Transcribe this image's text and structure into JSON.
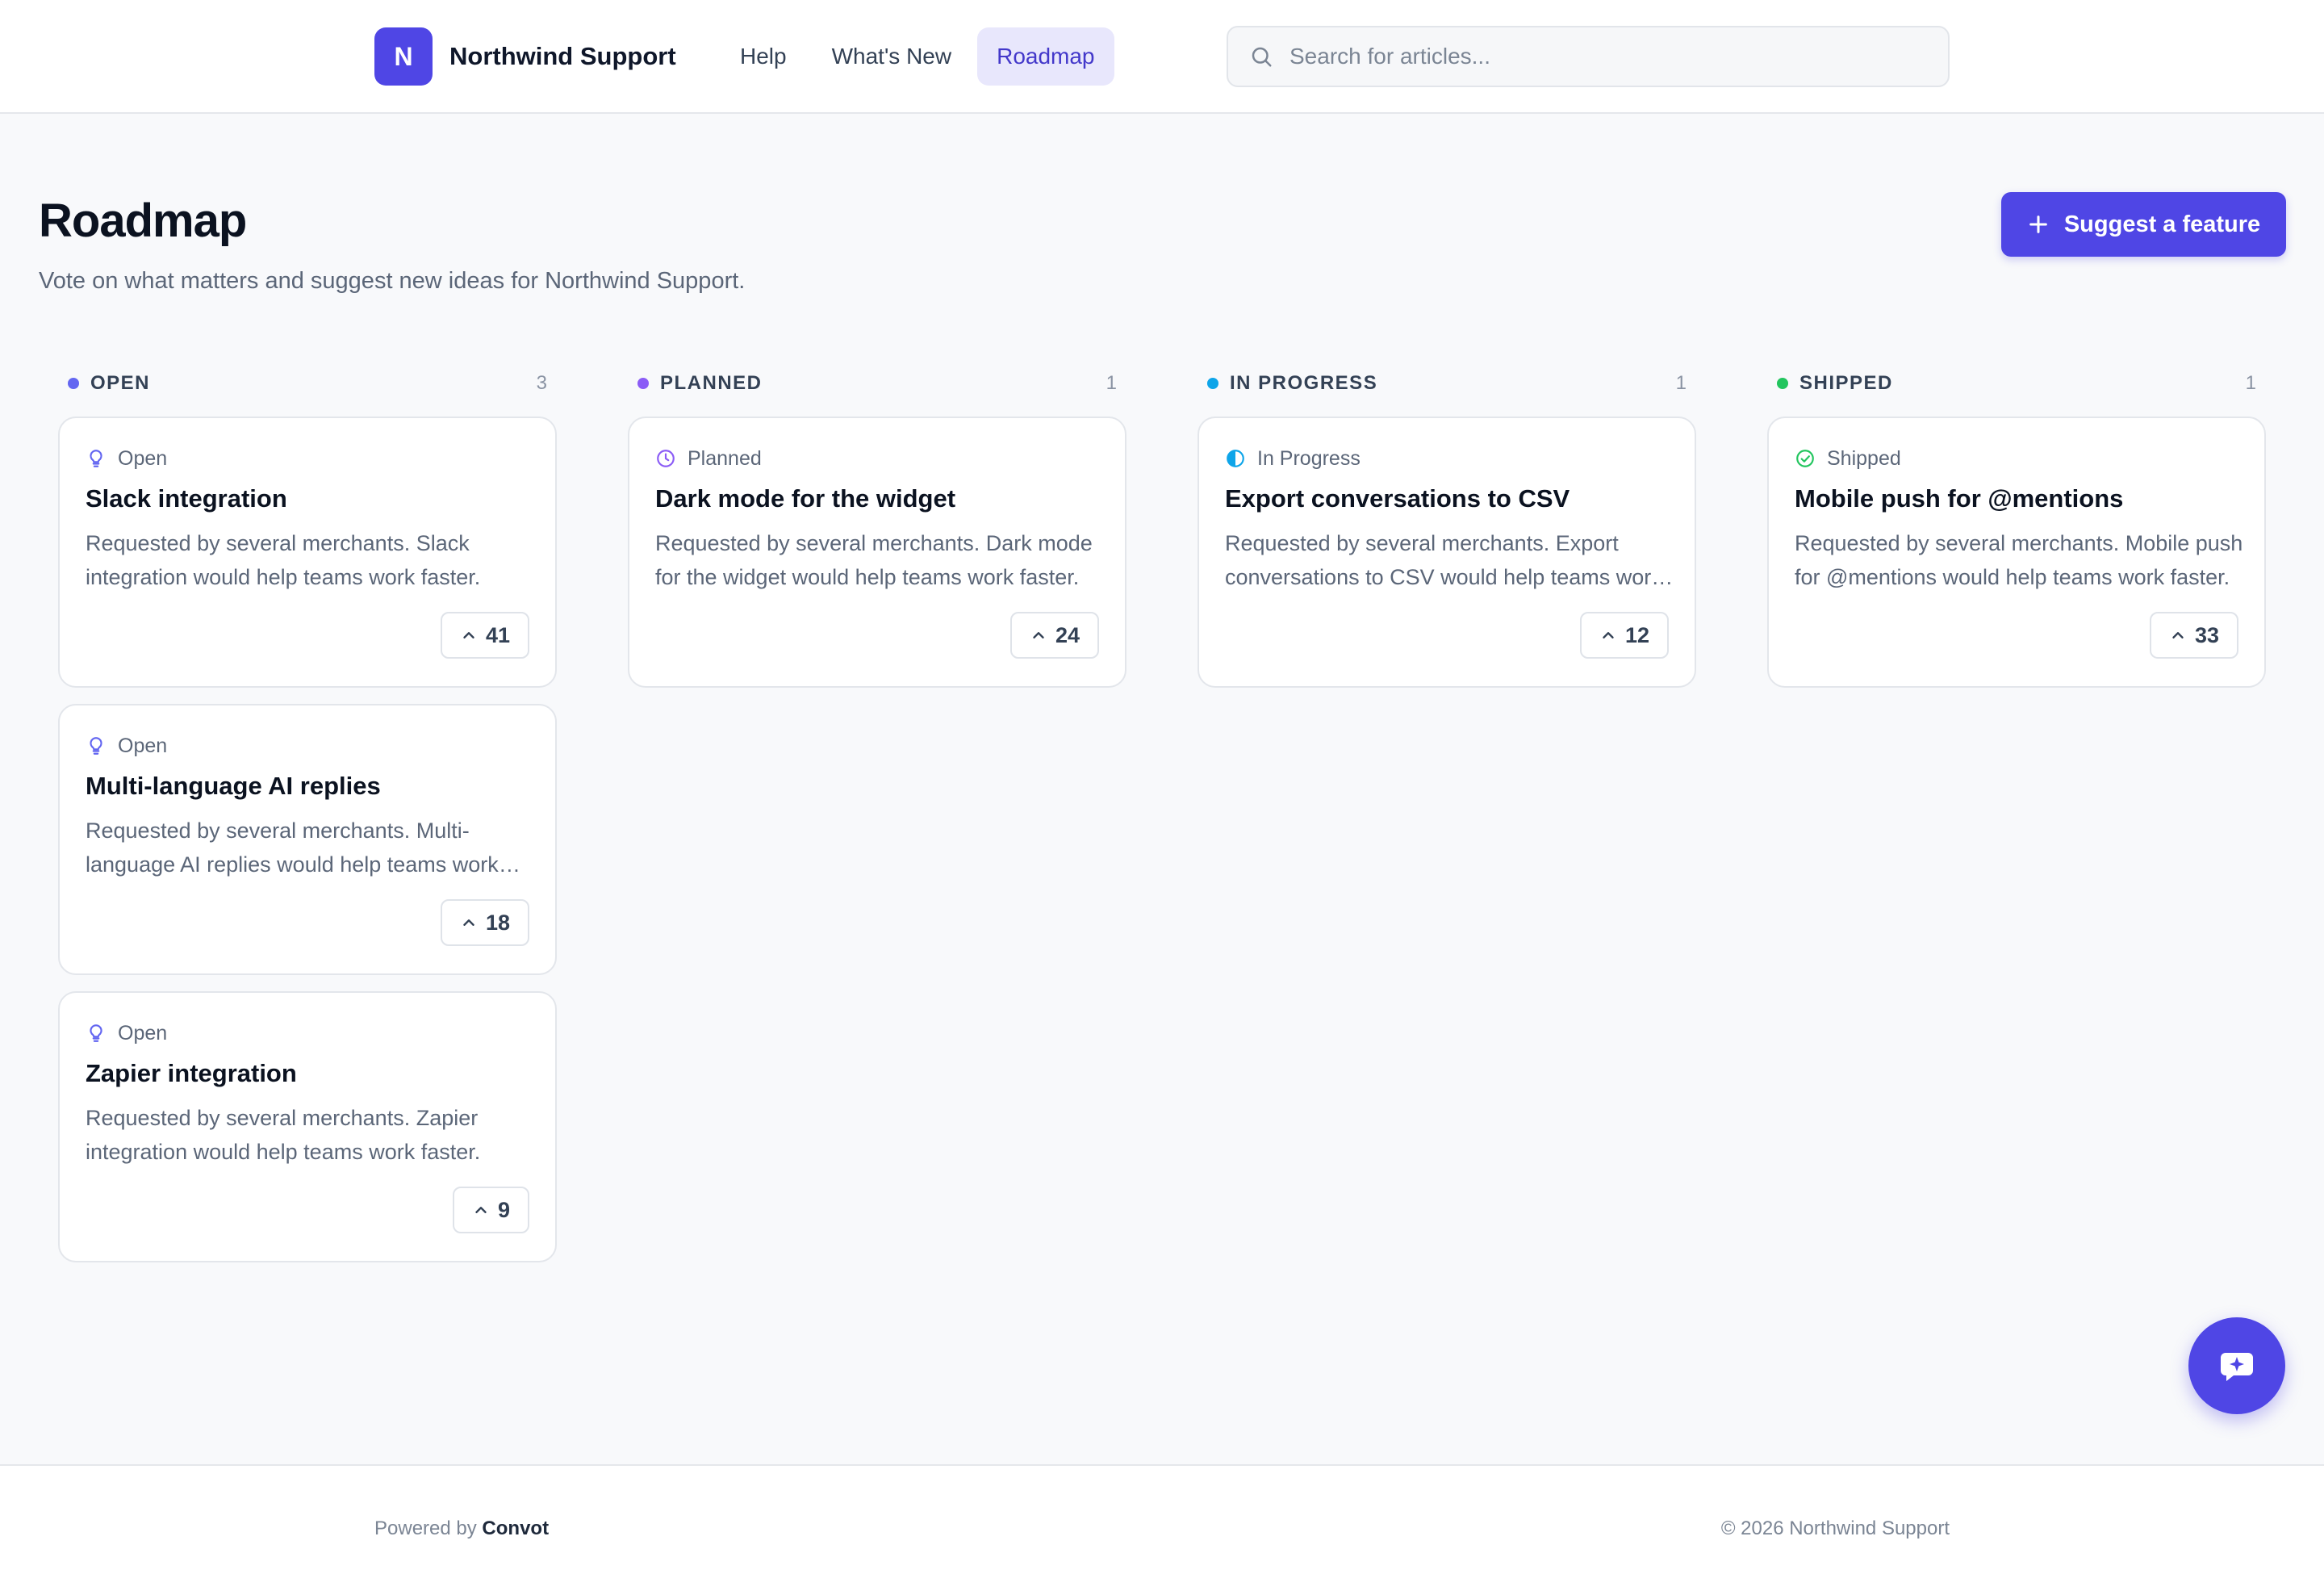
{
  "header": {
    "logo_letter": "N",
    "brand_name": "Northwind Support",
    "nav": [
      {
        "label": "Help"
      },
      {
        "label": "What's New"
      },
      {
        "label": "Roadmap",
        "active": true
      }
    ],
    "search_placeholder": "Search for articles..."
  },
  "page": {
    "title": "Roadmap",
    "subtitle": "Vote on what matters and suggest new ideas for Northwind Support.",
    "suggest_button": "Suggest a feature"
  },
  "columns": [
    {
      "title": "OPEN",
      "count": "3",
      "color": "#6366f1",
      "cards": [
        {
          "status": "Open",
          "title": "Slack integration",
          "description": "Requested by several merchants. Slack integration would help teams work faster.",
          "votes": "41"
        },
        {
          "status": "Open",
          "title": "Multi-language AI replies",
          "description": "Requested by several merchants. Multi-language AI replies would help teams work faster.",
          "votes": "18"
        },
        {
          "status": "Open",
          "title": "Zapier integration",
          "description": "Requested by several merchants. Zapier integration would help teams work faster.",
          "votes": "9"
        }
      ]
    },
    {
      "title": "PLANNED",
      "count": "1",
      "color": "#8b5cf6",
      "cards": [
        {
          "status": "Planned",
          "title": "Dark mode for the widget",
          "description": "Requested by several merchants. Dark mode for the widget would help teams work faster.",
          "votes": "24"
        }
      ]
    },
    {
      "title": "IN PROGRESS",
      "count": "1",
      "color": "#0ea5e9",
      "cards": [
        {
          "status": "In Progress",
          "title": "Export conversations to CSV",
          "description": "Requested by several merchants. Export conversations to CSV would help teams work faster.",
          "votes": "12"
        }
      ]
    },
    {
      "title": "SHIPPED",
      "count": "1",
      "color": "#22c55e",
      "cards": [
        {
          "status": "Shipped",
          "title": "Mobile push for @mentions",
          "description": "Requested by several merchants. Mobile push for @mentions would help teams work faster.",
          "votes": "33"
        }
      ]
    }
  ],
  "icons": {
    "open": "lightbulb-icon",
    "planned": "clock-icon",
    "in_progress": "half-circle-icon",
    "shipped": "check-circle-icon",
    "vote": "chevron-up-icon",
    "chat": "chat-sparkle-icon"
  },
  "footer": {
    "powered_prefix": "Powered by",
    "powered_brand": "Convot",
    "copyright": "© 2026 Northwind Support"
  }
}
